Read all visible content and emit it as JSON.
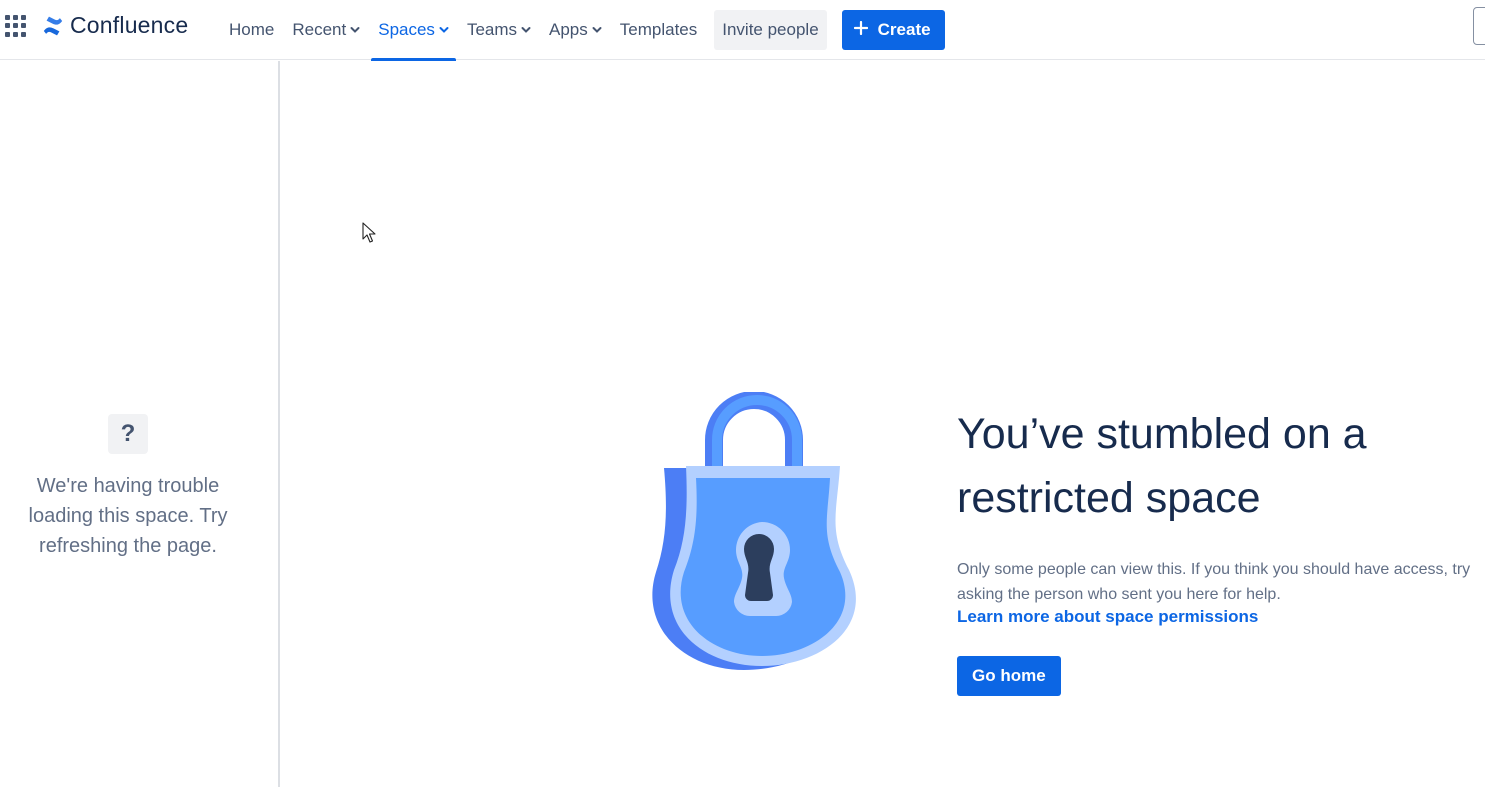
{
  "header": {
    "app_name": "Confluence",
    "nav": [
      {
        "label": "Home",
        "has_dropdown": false,
        "active": false
      },
      {
        "label": "Recent",
        "has_dropdown": true,
        "active": false
      },
      {
        "label": "Spaces",
        "has_dropdown": true,
        "active": true
      },
      {
        "label": "Teams",
        "has_dropdown": true,
        "active": false
      },
      {
        "label": "Apps",
        "has_dropdown": true,
        "active": false
      },
      {
        "label": "Templates",
        "has_dropdown": false,
        "active": false
      }
    ],
    "invite_label": "Invite people",
    "create_label": "Create"
  },
  "sidebar": {
    "help_icon": "?",
    "message": "We're having trouble loading this space. Try refreshing the page."
  },
  "main": {
    "title": "You’ve stumbled on a restricted space",
    "description": "Only some people can view this. If you think you should have access, try asking the person who sent you here for help.",
    "learn_more": "Learn more about space permissions",
    "go_home": "Go home"
  },
  "colors": {
    "brand_blue": "#0c66e4",
    "lock_light": "#579dff",
    "lock_dark": "#4c7ef5",
    "lock_rim": "#b3d0ff",
    "keyhole": "#2c3e5d"
  }
}
